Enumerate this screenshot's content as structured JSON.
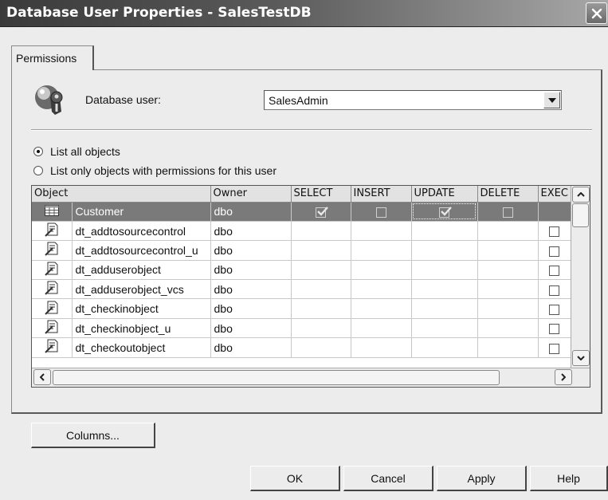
{
  "window": {
    "title": "Database User Properties - SalesTestDB"
  },
  "tabs": [
    {
      "label": "Permissions"
    }
  ],
  "user": {
    "label": "Database user:",
    "selected": "SalesAdmin"
  },
  "filter": {
    "all_label": "List all objects",
    "only_label": "List only objects with permissions for this user",
    "selected": "all"
  },
  "grid": {
    "columns": [
      "Object",
      "Owner",
      "SELECT",
      "INSERT",
      "UPDATE",
      "DELETE",
      "EXEC"
    ],
    "rows": [
      {
        "icon": "table-icon",
        "object": "Customer",
        "owner": "dbo",
        "select": true,
        "insert": false,
        "update": true,
        "delete": false,
        "exec": null,
        "selected": true
      },
      {
        "icon": "stored-procedure-icon",
        "object": "dt_addtosourcecontrol",
        "owner": "dbo",
        "exec": false
      },
      {
        "icon": "stored-procedure-icon",
        "object": "dt_addtosourcecontrol_u",
        "owner": "dbo",
        "exec": false
      },
      {
        "icon": "stored-procedure-icon",
        "object": "dt_adduserobject",
        "owner": "dbo",
        "exec": false
      },
      {
        "icon": "stored-procedure-icon",
        "object": "dt_adduserobject_vcs",
        "owner": "dbo",
        "exec": false
      },
      {
        "icon": "stored-procedure-icon",
        "object": "dt_checkinobject",
        "owner": "dbo",
        "exec": false
      },
      {
        "icon": "stored-procedure-icon",
        "object": "dt_checkinobject_u",
        "owner": "dbo",
        "exec": false
      },
      {
        "icon": "stored-procedure-icon",
        "object": "dt_checkoutobject",
        "owner": "dbo",
        "exec": false
      }
    ]
  },
  "buttons": {
    "columns": "Columns...",
    "ok": "OK",
    "cancel": "Cancel",
    "apply": "Apply",
    "help": "Help"
  },
  "colors": {
    "selected_row": "#7a7a7a",
    "titlebar_dark": "#3a3a3a",
    "dialog_bg": "#ececec"
  }
}
